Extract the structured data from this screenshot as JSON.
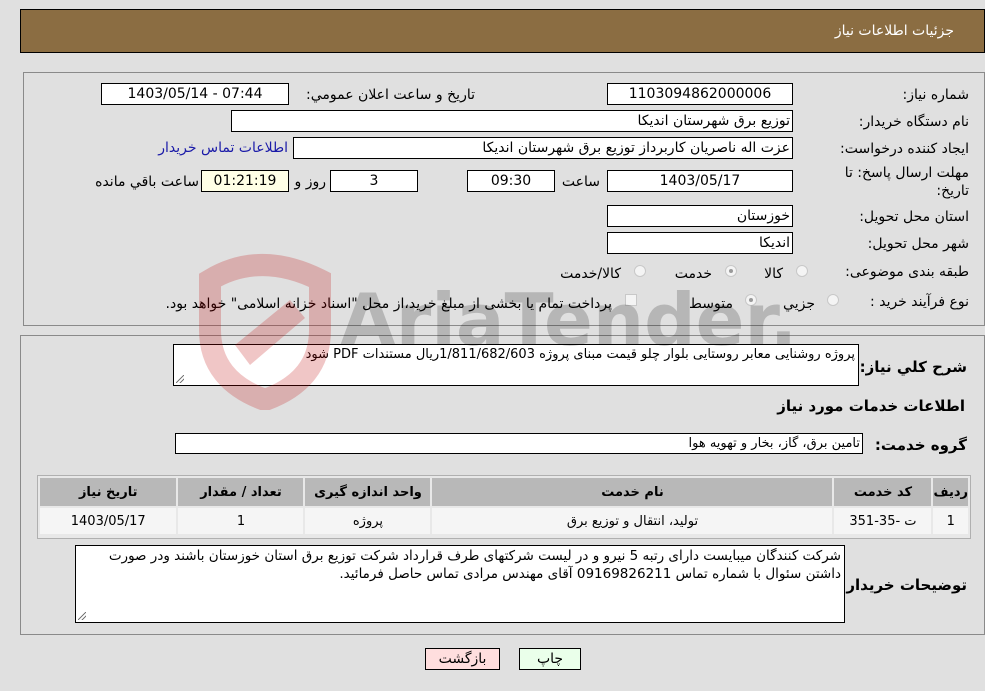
{
  "header": {
    "title": "جزئیات اطلاعات نیاز"
  },
  "form": {
    "need_number_label": "شماره نیاز:",
    "need_number": "1103094862000006",
    "announce_label": "تاریخ و ساعت اعلان عمومي:",
    "announce_value": "1403/05/14 - 07:44",
    "buyer_org_label": "نام دستگاه خریدار:",
    "buyer_org": "توزیع برق شهرستان اندیکا",
    "creator_label": "ایجاد کننده درخواست:",
    "creator": "عزت اله ناصریان کاربرداز توزیع برق شهرستان اندیکا",
    "contact_link": "اطلاعات تماس خریدار",
    "deadline_label": "مهلت ارسال پاسخ: تا تاریخ:",
    "deadline_date": "1403/05/17",
    "time_label": "ساعت",
    "deadline_time": "09:30",
    "days_value": "3",
    "days_label": "روز و",
    "remaining_time": "01:21:19",
    "remaining_label": "ساعت باقي مانده",
    "province_label": "استان محل تحویل:",
    "province": "خوزستان",
    "city_label": "شهر محل تحویل:",
    "city": "اندیکا",
    "category_label": "طبقه بندی موضوعی:",
    "category_options": [
      {
        "label": "کالا",
        "selected": false
      },
      {
        "label": "خدمت",
        "selected": true
      },
      {
        "label": "کالا/خدمت",
        "selected": false
      }
    ],
    "process_label": "نوع فرآیند خرید :",
    "process_options": [
      {
        "label": "جزيي",
        "selected": false
      },
      {
        "label": "متوسط",
        "selected": true
      }
    ],
    "treasury_checkbox_checked": false,
    "treasury_note": "پرداخت تمام یا بخشی از مبلغ خرید،از محل \"اسناد خزانه اسلامی\" خواهد بود."
  },
  "details": {
    "summary_label": "شرح كلي نياز:",
    "summary": "پروژه روشنایی معابر روستایی بلوار چلو قیمت مبنای پروژه 1/811/682/603ریال مستندات PDF شود",
    "services_title": "اطلاعات خدمات مورد نیاز",
    "service_group_label": "گروه خدمت:",
    "service_group": "تامین برق، گاز، بخار و تهویه هوا",
    "table": {
      "headers": [
        "ردیف",
        "کد خدمت",
        "نام خدمت",
        "واحد اندازه گیری",
        "تعداد / مقدار",
        "تاریخ نیاز"
      ],
      "rows": [
        [
          "1",
          "ت -35-351",
          "تولید، انتقال و توزیع برق",
          "پروژه",
          "1",
          "1403/05/17"
        ]
      ]
    },
    "buyer_notes_label": "توضیحات خریدار:",
    "buyer_notes": "شرکت کنندگان میبایست دارای رتبه 5 نیرو و در لیست شرکتهای طرف قرارداد شرکت توزیع برق استان خوزستان باشند ودر صورت داشتن سئوال با شماره تماس 09169826211 آقای مهندس مرادی تماس حاصل فرمائید."
  },
  "buttons": {
    "print": "چاپ",
    "back": "بازگشت"
  },
  "watermark": {
    "text": "AriaTender.neT"
  },
  "colors": {
    "header_bg": "#8b6d42",
    "print_bg": "#eaffea",
    "back_bg": "#ffdede",
    "link": "#1a1aa8"
  }
}
